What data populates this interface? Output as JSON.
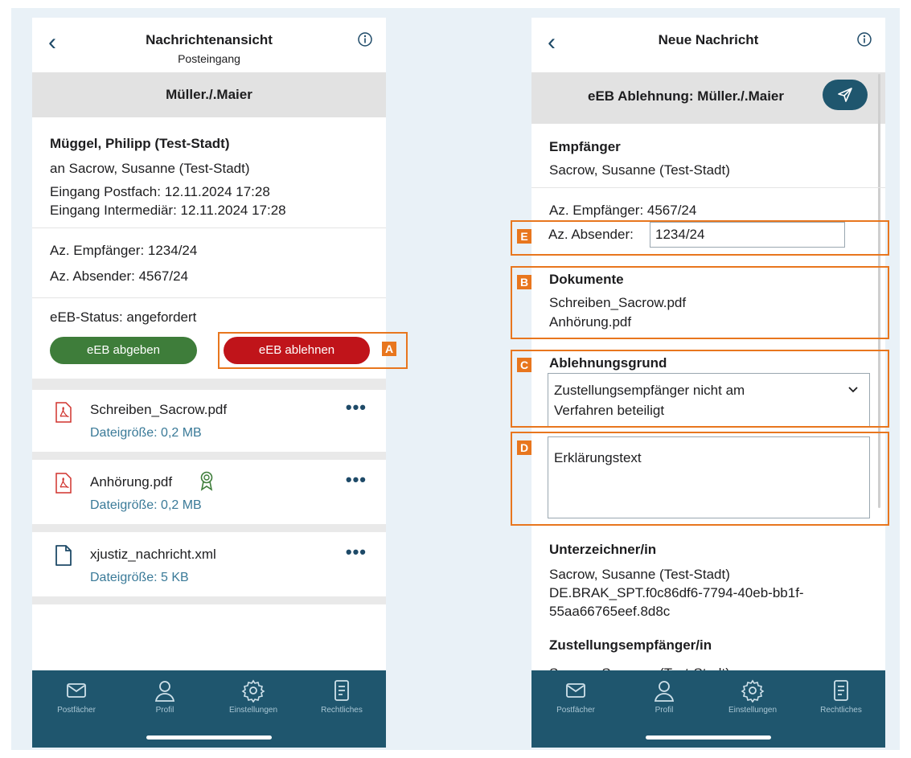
{
  "left": {
    "header": {
      "title": "Nachrichtenansicht",
      "subtitle": "Posteingang"
    },
    "case_title": "Müller./.Maier",
    "sender": {
      "name": "Müggel, Philipp (Test-Stadt)",
      "recipient_line": "an Sacrow, Susanne (Test-Stadt)",
      "received_mailbox": "Eingang Postfach: 12.11.2024 17:28",
      "received_intermediary": "Eingang Intermediär: 12.11.2024 17:28"
    },
    "refs": {
      "recipient_ref": "Az. Empfänger: 1234/24",
      "sender_ref": "Az. Absender: 4567/24"
    },
    "eeb": {
      "status": "eEB-Status: angefordert",
      "accept_label": "eEB abgeben",
      "reject_label": "eEB ablehnen"
    },
    "files": [
      {
        "name": "Schreiben_Sacrow.pdf",
        "size": "Dateigröße: 0,2 MB",
        "icon": "pdf-icon"
      },
      {
        "name": "Anhörung.pdf",
        "size": "Dateigröße: 0,2 MB",
        "icon": "pdf-icon",
        "badge": "certificate-icon"
      },
      {
        "name": "xjustiz_nachricht.xml",
        "size": "Dateigröße: 5 KB",
        "icon": "document-icon"
      }
    ],
    "more_label": "•••"
  },
  "right": {
    "header": {
      "title": "Neue Nachricht"
    },
    "subject": "eEB Ablehnung: Müller./.Maier",
    "recipient_label": "Empfänger",
    "recipient_value": "Sacrow, Susanne (Test-Stadt)",
    "recipient_ref": "Az. Empfänger: 4567/24",
    "sender_ref_label": "Az. Absender:",
    "sender_ref_value": "1234/24",
    "documents_label": "Dokumente",
    "documents": [
      "Schreiben_Sacrow.pdf",
      "Anhörung.pdf"
    ],
    "reason_label": "Ablehnungsgrund",
    "reason_value_line1": "Zustellungsempfänger nicht am",
    "reason_value_line2": "Verfahren beteiligt",
    "explanation_placeholder": "Erklärungstext",
    "signer_label": "Unterzeichner/in",
    "signer_name": "Sacrow, Susanne (Test-Stadt)",
    "signer_id_line1": "DE.BRAK_SPT.f0c86df6-7794-40eb-bb1f-",
    "signer_id_line2": "55aa66765eef.8d8c",
    "delivery_recipient_label": "Zustellungsempfänger/in",
    "delivery_recipient_partial": "Sacrow, Susanne (Test-Stadt)"
  },
  "tabbar": [
    "Postfächer",
    "Profil",
    "Einstellungen",
    "Rechtliches"
  ],
  "annotations": {
    "a": "A",
    "b": "B",
    "c": "C",
    "d": "D",
    "e": "E"
  },
  "colors": {
    "brand": "#1f566e",
    "accept": "#3e7d3a",
    "reject": "#c0141a",
    "annotation": "#e8761e",
    "link": "#3a7a98"
  }
}
